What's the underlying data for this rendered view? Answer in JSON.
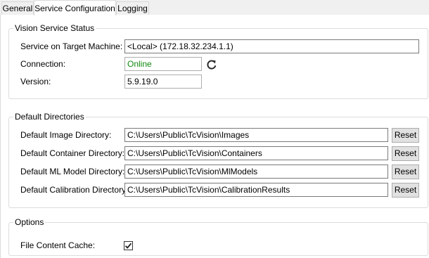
{
  "tabs": [
    {
      "label": "General",
      "active": false
    },
    {
      "label": "Service Configuration",
      "active": true
    },
    {
      "label": "Logging",
      "active": false
    }
  ],
  "vision_status": {
    "title": "Vision Service Status",
    "target_label": "Service on Target Machine:",
    "target_value": "<Local> (172.18.32.234.1.1)",
    "connection_label": "Connection:",
    "connection_value": "Online",
    "version_label": "Version:",
    "version_value": "5.9.19.0"
  },
  "directories": {
    "title": "Default Directories",
    "reset_label": "Reset",
    "items": [
      {
        "label": "Default Image Directory:",
        "value": "C:\\Users\\Public\\TcVision\\Images"
      },
      {
        "label": "Default Container Directory:",
        "value": "C:\\Users\\Public\\TcVision\\Containers"
      },
      {
        "label": "Default ML Model Directory:",
        "value": "C:\\Users\\Public\\TcVision\\MlModels"
      },
      {
        "label": "Default Calibration Directory:",
        "value": "C:\\Users\\Public\\TcVision\\CalibrationResults"
      }
    ]
  },
  "options": {
    "title": "Options",
    "file_cache_label": "File Content Cache:",
    "file_cache_checked": true
  },
  "colors": {
    "online": "#108a10",
    "panel_bg": "#ffffff",
    "window_bg": "#f0f0f0"
  }
}
